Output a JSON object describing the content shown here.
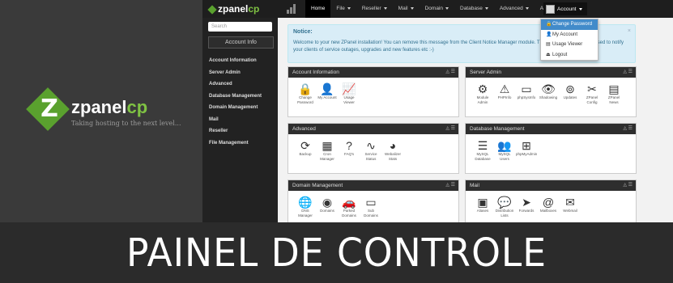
{
  "brand": {
    "name_part1": "zpanel",
    "name_part2": "cp",
    "tagline": "Taking hosting to the next level...",
    "z_letter": "Z"
  },
  "topbar": {
    "logo_part1": "zpanel",
    "logo_part2": "cp",
    "nav": [
      {
        "label": "Home",
        "active": true,
        "caret": false
      },
      {
        "label": "File",
        "caret": true
      },
      {
        "label": "Reseller",
        "caret": true
      },
      {
        "label": "Mail",
        "caret": true
      },
      {
        "label": "Domain",
        "caret": true
      },
      {
        "label": "Database",
        "caret": true
      },
      {
        "label": "Advanced",
        "caret": true
      },
      {
        "label": "Admin",
        "caret": true
      }
    ],
    "account_label": "Account"
  },
  "account_menu": [
    {
      "label": "Change Password",
      "icon": "lock-icon",
      "active": true
    },
    {
      "label": "My Account",
      "icon": "user-icon"
    },
    {
      "label": "Usage Viewer",
      "icon": "chart-icon"
    },
    {
      "label": "Logout",
      "icon": "logout-icon"
    }
  ],
  "sidebar": {
    "search_placeholder": "Search",
    "heading": "Account Info",
    "items": [
      "Account Information",
      "Server Admin",
      "Advanced",
      "Database Management",
      "Domain Management",
      "Mail",
      "Reseller",
      "File Management"
    ]
  },
  "notice": {
    "title": "Notice:",
    "text": "Welcome to your new ZPanel installation! You can remove this message from the Client Notice Manager module. This message can also be used to notify your clients of service outages, upgrades and new features etc :-)",
    "close": "×"
  },
  "panels": [
    {
      "title": "Account Information",
      "tiles": [
        {
          "label": "Change Password",
          "icon": "lock-icon",
          "glyph": "🔒"
        },
        {
          "label": "My Account",
          "icon": "user-card-icon",
          "glyph": "👤"
        },
        {
          "label": "Usage Viewer",
          "icon": "chart-icon",
          "glyph": "📈"
        }
      ]
    },
    {
      "title": "Server Admin",
      "tiles": [
        {
          "label": "Module Admin",
          "icon": "gears-icon",
          "glyph": "⚙"
        },
        {
          "label": "PHPInfo",
          "icon": "warning-icon",
          "glyph": "⚠"
        },
        {
          "label": "phpSysInfo",
          "icon": "terminal-icon",
          "glyph": "▭"
        },
        {
          "label": "Shadowing",
          "icon": "eye-icon",
          "glyph": "👁"
        },
        {
          "label": "Updates",
          "icon": "broadcast-icon",
          "glyph": "⊚"
        },
        {
          "label": "ZPanel Config",
          "icon": "tools-icon",
          "glyph": "✂"
        },
        {
          "label": "ZPanel News",
          "icon": "newspaper-icon",
          "glyph": "▤"
        }
      ]
    },
    {
      "title": "Advanced",
      "tiles": [
        {
          "label": "Backup",
          "icon": "refresh-icon",
          "glyph": "⟳"
        },
        {
          "label": "Cron Manager",
          "icon": "calendar-icon",
          "glyph": "▦"
        },
        {
          "label": "FAQ's",
          "icon": "question-icon",
          "glyph": "?"
        },
        {
          "label": "Service Status",
          "icon": "pulse-icon",
          "glyph": "∿"
        },
        {
          "label": "Webalizer Stats",
          "icon": "pie-icon",
          "glyph": "◕"
        }
      ]
    },
    {
      "title": "Database Management",
      "tiles": [
        {
          "label": "MySQL Database",
          "icon": "database-icon",
          "glyph": "☰"
        },
        {
          "label": "MySQL Users",
          "icon": "users-icon",
          "glyph": "👥"
        },
        {
          "label": "phpMyAdmin",
          "icon": "sitemap-icon",
          "glyph": "⊞"
        }
      ]
    },
    {
      "title": "Domain Management",
      "tiles": [
        {
          "label": "DNS Manager",
          "icon": "globe-icon",
          "glyph": "🌐"
        },
        {
          "label": "Domains",
          "icon": "earth-icon",
          "glyph": "◉"
        },
        {
          "label": "Parked Domains",
          "icon": "car-icon",
          "glyph": "🚗"
        },
        {
          "label": "Sub Domains",
          "icon": "www-icon",
          "glyph": "▭"
        }
      ]
    },
    {
      "title": "Mail",
      "tiles": [
        {
          "label": "Aliases",
          "icon": "contact-card-icon",
          "glyph": "▣"
        },
        {
          "label": "Distribution Lists",
          "icon": "chat-icon",
          "glyph": "💬"
        },
        {
          "label": "Forwards",
          "icon": "send-icon",
          "glyph": "➤"
        },
        {
          "label": "Mailboxes",
          "icon": "at-icon",
          "glyph": "@"
        },
        {
          "label": "Webmail",
          "icon": "envelope-icon",
          "glyph": "✉"
        }
      ]
    }
  ],
  "panel_controls": "◬ ☰",
  "banner": {
    "text": "PAINEL DE CONTROLE"
  },
  "colors": {
    "brand_green": "#7fc243",
    "notice_bg": "#d9edf7",
    "dropdown_active": "#428bca",
    "dark_bar": "#1e1e1e"
  }
}
